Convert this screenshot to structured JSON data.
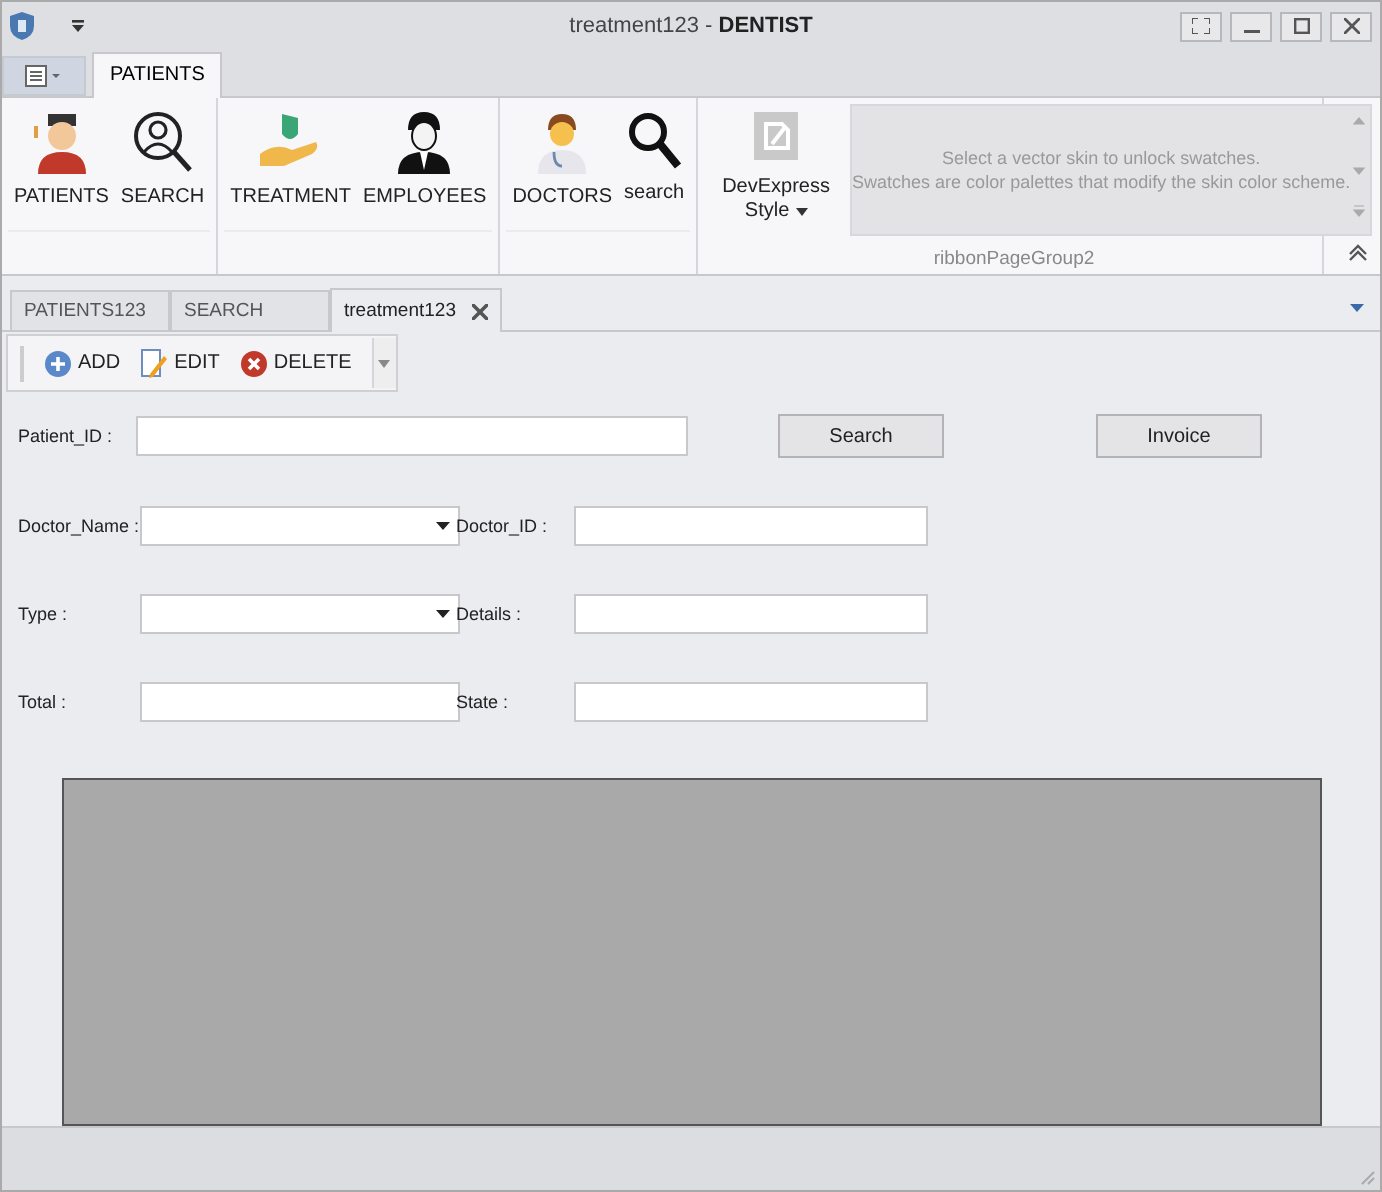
{
  "window": {
    "title": "treatment123 - **DENTIST**"
  },
  "ribbon_tabs": [
    {
      "label": "PATIENTS",
      "selected": true
    }
  ],
  "ribbon_groups": [
    {
      "buttons": [
        {
          "label": "PATIENTS"
        },
        {
          "label": "SEARCH"
        }
      ]
    },
    {
      "buttons": [
        {
          "label": "TREATMENT"
        },
        {
          "label": "EMPLOYEES"
        }
      ]
    },
    {
      "buttons": [
        {
          "label": "DOCTORS"
        },
        {
          "label": "search"
        }
      ]
    }
  ],
  "skin_group": {
    "style_button": "DevExpress Style",
    "gallery_lines": [
      "Select a vector skin to unlock swatches.",
      "Swatches are color palettes that modify the skin color scheme."
    ],
    "caption": "ribbonPageGroup2"
  },
  "document_tabs": [
    {
      "label": "PATIENTS123",
      "selected": false
    },
    {
      "label": "SEARCH",
      "selected": false
    },
    {
      "label": "treatment123",
      "selected": true
    }
  ],
  "toolbar": [
    {
      "label": "ADD"
    },
    {
      "label": "EDIT"
    },
    {
      "label": "DELETE"
    }
  ],
  "patient_row": {
    "label": "Patient_ID :",
    "buttons": [
      "Search",
      "Invoice"
    ]
  },
  "fields": [
    {
      "label": "Doctor_Name :",
      "kind": "dropdown"
    },
    {
      "label": "Doctor_ID :",
      "kind": "text"
    },
    {
      "label": "Type :",
      "kind": "dropdown"
    },
    {
      "label": "Details :",
      "kind": "text"
    },
    {
      "label": "Total :",
      "kind": "text"
    },
    {
      "label": "State :",
      "kind": "text"
    }
  ]
}
